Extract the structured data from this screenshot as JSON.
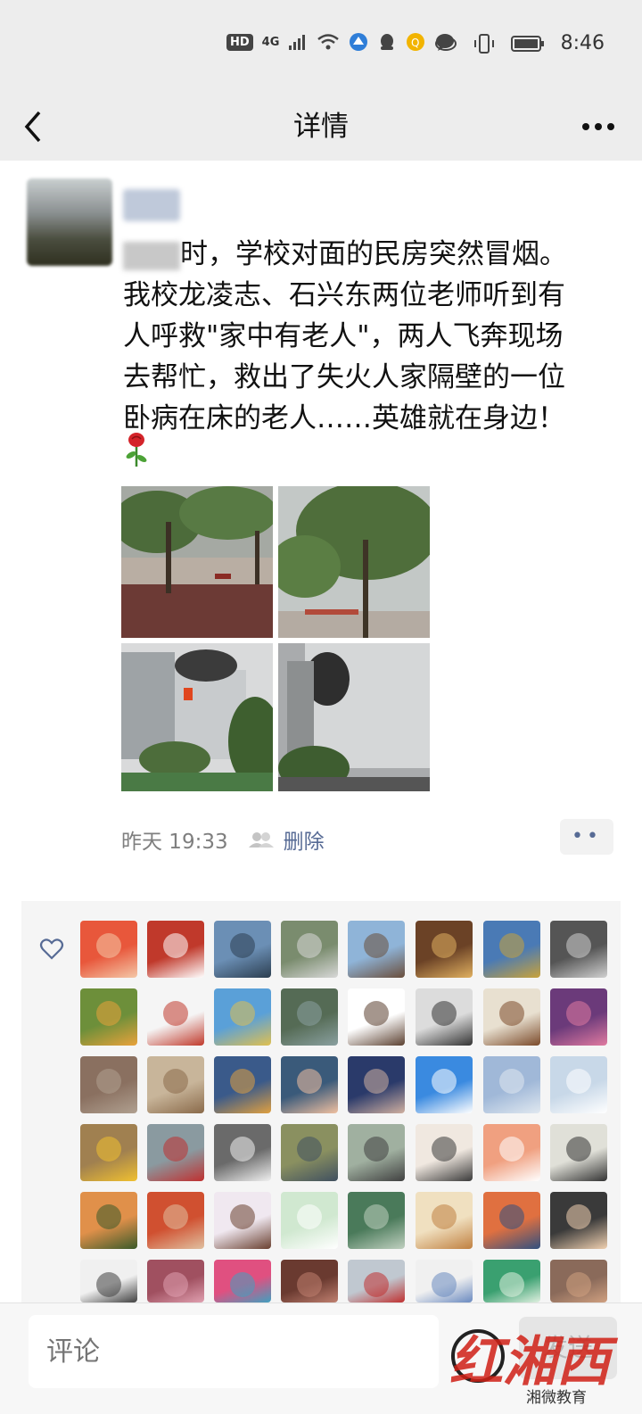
{
  "status_bar": {
    "badge_hd": "HD",
    "network": "4G",
    "time": "8:46"
  },
  "nav": {
    "title": "详情"
  },
  "post": {
    "text_lines": [
      "时，学校对面的民房突然冒烟。",
      "我校龙凌志、石兴东两位老师听到有",
      "人呼救\"家中有老人\"，两人飞奔现场",
      "去帮忙，救出了失火人家隔壁的一位",
      "卧病在床的老人……英雄就在身边！"
    ],
    "time": "昨天 19:33",
    "delete_label": "删除",
    "more_label": "••"
  },
  "comment": {
    "placeholder": "评论",
    "send_label": "发送"
  },
  "watermark": {
    "logo_text": "红湘西",
    "account": "湘微教育"
  },
  "colors": {
    "link": "#576b95",
    "background": "#ededed",
    "watermark_red": "#d02016"
  }
}
